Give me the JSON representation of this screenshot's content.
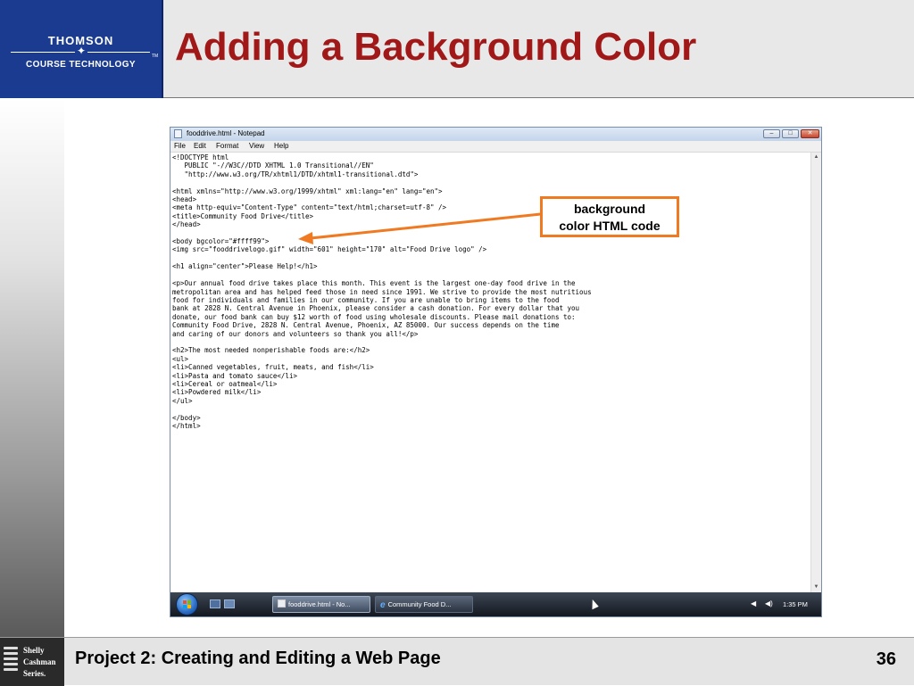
{
  "slide": {
    "title": "Adding a Background Color",
    "footer_title": "Project 2: Creating and Editing a Web Page",
    "slide_number": "36"
  },
  "logo": {
    "line1": "THOMSON",
    "line2": "COURSE TECHNOLOGY",
    "tm": "TM"
  },
  "series": {
    "line1": "Shelly",
    "line2": "Cashman",
    "line3": "Series."
  },
  "window": {
    "title": "fooddrive.html - Notepad",
    "menu": [
      "File",
      "Edit",
      "Format",
      "View",
      "Help"
    ],
    "code": "<!DOCTYPE html\n   PUBLIC \"-//W3C//DTD XHTML 1.0 Transitional//EN\"\n   \"http://www.w3.org/TR/xhtml1/DTD/xhtml1-transitional.dtd\">\n\n<html xmlns=\"http://www.w3.org/1999/xhtml\" xml:lang=\"en\" lang=\"en\">\n<head>\n<meta http-equiv=\"Content-Type\" content=\"text/html;charset=utf-8\" />\n<title>Community Food Drive</title>\n</head>\n\n<body bgcolor=\"#ffff99\">\n<img src=\"fooddrivelogo.gif\" width=\"601\" height=\"170\" alt=\"Food Drive logo\" />\n\n<h1 align=\"center\">Please Help!</h1>\n\n<p>Our annual food drive takes place this month. This event is the largest one-day food drive in the\nmetropolitan area and has helped feed those in need since 1991. We strive to provide the most nutritious\nfood for individuals and families in our community. If you are unable to bring items to the food\nbank at 2828 N. Central Avenue in Phoenix, please consider a cash donation. For every dollar that you\ndonate, our food bank can buy $12 worth of food using wholesale discounts. Please mail donations to:\nCommunity Food Drive, 2828 N. Central Avenue, Phoenix, AZ 85000. Our success depends on the time\nand caring of our donors and volunteers so thank you all!</p>\n\n<h2>The most needed nonperishable foods are:</h2>\n<ul>\n<li>Canned vegetables, fruit, meats, and fish</li>\n<li>Pasta and tomato sauce</li>\n<li>Cereal or oatmeal</li>\n<li>Powdered milk</li>\n</ul>\n\n</body>\n</html>"
  },
  "taskbar": {
    "items": [
      {
        "label": "fooddrive.html - No...",
        "active": true
      },
      {
        "label": "Community Food D...",
        "active": false
      }
    ],
    "clock": "1:35 PM"
  },
  "callout": {
    "line1": "background",
    "line2": "color HTML code"
  },
  "colors": {
    "title_red": "#a01818",
    "logo_blue": "#1a3b8f",
    "callout_orange": "#f07a22"
  },
  "icons": {
    "start": "windows-orb-icon",
    "app": "notepad-icon",
    "ie": "internet-explorer-icon",
    "volume": "speaker-icon"
  }
}
